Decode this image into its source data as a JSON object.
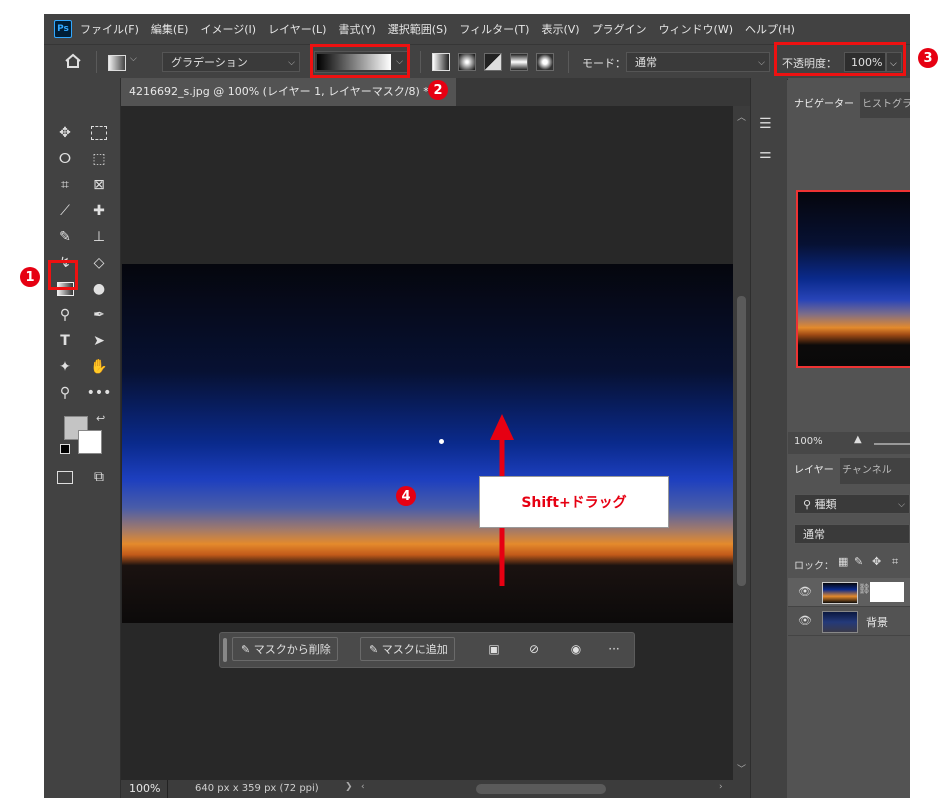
{
  "menubar": {
    "logo": "Ps",
    "items": [
      "ファイル(F)",
      "編集(E)",
      "イメージ(I)",
      "レイヤー(L)",
      "書式(Y)",
      "選択範囲(S)",
      "フィルター(T)",
      "表示(V)",
      "プラグイン",
      "ウィンドウ(W)",
      "ヘルプ(H)"
    ]
  },
  "options": {
    "preset_label": "グラデーション",
    "mode_label": "モード：",
    "mode_value": "通常",
    "opacity_label": "不透明度：",
    "opacity_value": "100%"
  },
  "document": {
    "tab_title": "4216692_s.jpg @ 100% (レイヤー 1, レイヤーマスク/8) *",
    "tab_close": "×",
    "zoom": "100%",
    "info": "640 px x 359 px (72 ppi)"
  },
  "context_bar": {
    "subtract_label": "マスクから削除",
    "add_label": "マスクに追加",
    "more": "···"
  },
  "annotations": {
    "step1": "1",
    "step2": "2",
    "step3": "3",
    "step4": "4",
    "drag_instruction": "Shift+ドラッグ",
    "accent_color": "#e60012"
  },
  "panels": {
    "navigator_tab": "ナビゲーター",
    "histogram_tab": "ヒストグラム",
    "nav_zoom": "100%",
    "layers_tab": "レイヤー",
    "channels_tab": "チャンネル",
    "filter_label": "種類",
    "blend_mode": "通常",
    "lock_label": "ロック：",
    "background_layer": "背景"
  }
}
